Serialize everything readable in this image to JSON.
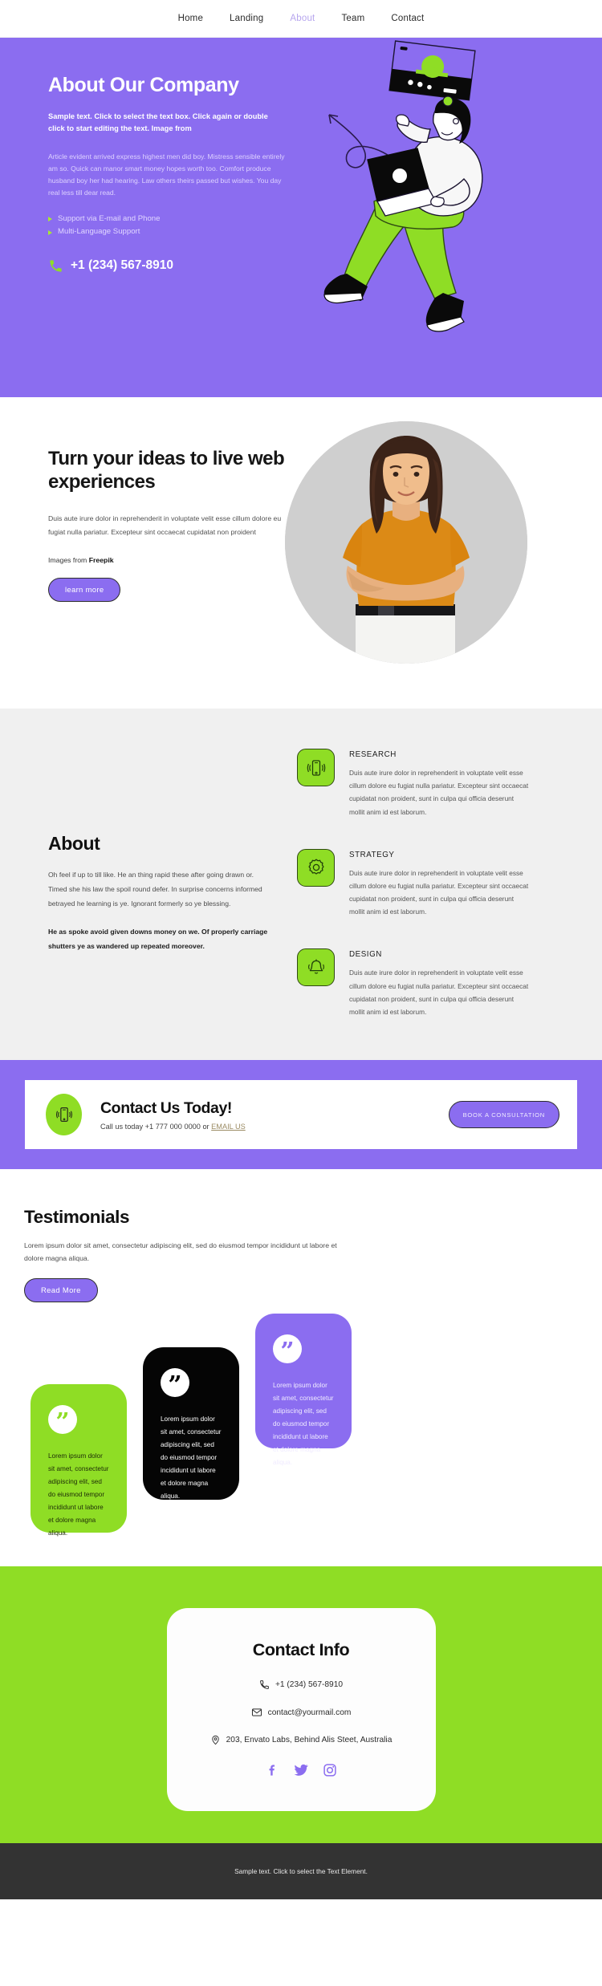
{
  "nav": {
    "items": [
      {
        "label": "Home",
        "active": false
      },
      {
        "label": "Landing",
        "active": false
      },
      {
        "label": "About",
        "active": true
      },
      {
        "label": "Team",
        "active": false
      },
      {
        "label": "Contact",
        "active": false
      }
    ]
  },
  "hero": {
    "title": "About Our Company",
    "lead": "Sample text. Click to select the text box. Click again or double click to start editing the text. Image from",
    "body": "Article evident arrived express highest men did boy. Mistress sensible entirely am so. Quick can manor smart money hopes worth too. Comfort produce husband boy her had hearing. Law others theirs passed but wishes. You day real less till dear read.",
    "bullets": [
      "Support via E-mail and Phone",
      "Multi-Language Support"
    ],
    "phone": "+1 (234) 567-8910",
    "phone_icon": "phone-icon",
    "bg_color": "#8B6DF0",
    "accent_color": "#8FDD25"
  },
  "ideas": {
    "title": "Turn your ideas to live web experiences",
    "body": "Duis aute irure dolor in reprehenderit in voluptate velit esse cillum dolore eu fugiat nulla pariatur. Excepteur sint occaecat cupidatat non proident",
    "credit_prefix": "Images from ",
    "credit_brand": "Freepik",
    "button": "learn more",
    "photo_alt": "portrait-photo"
  },
  "about": {
    "title": "About",
    "paragraph1": "Oh feel if up to till like. He an thing rapid these after going drawn or. Timed she his law the spoil round defer. In surprise concerns informed betrayed he learning is ye. Ignorant formerly so ye blessing.",
    "paragraph2": "He as spoke avoid given downs money on we. Of properly carriage shutters ye as wandered up repeated moreover.",
    "features": [
      {
        "icon": "mobile-vibrate-icon",
        "title": "RESEARCH",
        "text": "Duis aute irure dolor in reprehenderit in voluptate velit esse cillum dolore eu fugiat nulla pariatur. Excepteur sint occaecat cupidatat non proident, sunt in culpa qui officia deserunt mollit anim id est laborum."
      },
      {
        "icon": "gear-icon",
        "title": "STRATEGY",
        "text": "Duis aute irure dolor in reprehenderit in voluptate velit esse cillum dolore eu fugiat nulla pariatur. Excepteur sint occaecat cupidatat non proident, sunt in culpa qui officia deserunt mollit anim id est laborum."
      },
      {
        "icon": "bell-icon",
        "title": "DESIGN",
        "text": "Duis aute irure dolor in reprehenderit in voluptate velit esse cillum dolore eu fugiat nulla pariatur. Excepteur sint occaecat cupidatat non proident, sunt in culpa qui officia deserunt mollit anim id est laborum."
      }
    ]
  },
  "cta": {
    "icon": "mobile-vibrate-icon",
    "title": "Contact Us Today!",
    "subtitle_prefix": "Call us today +1 777 000 0000 or ",
    "email_link": "EMAIL US",
    "button": "BOOK A CONSULTATION"
  },
  "testimonials": {
    "title": "Testimonials",
    "subtitle": "Lorem ipsum dolor sit amet, consectetur adipiscing elit, sed do eiusmod tempor incididunt ut labore et dolore magna aliqua.",
    "button": "Read More",
    "cards": [
      {
        "text": "Lorem ipsum dolor sit amet, consectetur adipiscing elit, sed do eiusmod tempor incididunt ut labore et dolore magna aliqua.",
        "color": "#8FDD25",
        "quote_glyph": "”"
      },
      {
        "text": "Lorem ipsum dolor sit amet, consectetur adipiscing elit, sed do eiusmod tempor incididunt ut labore et dolore magna aliqua.",
        "color": "#050505",
        "quote_glyph": "”"
      },
      {
        "text": "Lorem ipsum dolor sit amet, consectetur adipiscing elit, sed do eiusmod tempor incididunt ut labore et dolore magna aliqua.",
        "color": "#8B6DF0",
        "quote_glyph": "”"
      }
    ]
  },
  "contact_info": {
    "title": "Contact Info",
    "phone": "+1 (234) 567-8910",
    "email": "contact@yourmail.com",
    "address": "203, Envato Labs, Behind Alis Steet, Australia",
    "phone_icon": "phone-icon",
    "email_icon": "envelope-icon",
    "address_icon": "location-pin-icon",
    "socials": [
      {
        "name": "facebook-icon"
      },
      {
        "name": "twitter-icon"
      },
      {
        "name": "instagram-icon"
      }
    ]
  },
  "footer": {
    "text": "Sample text. Click to select the Text Element."
  }
}
